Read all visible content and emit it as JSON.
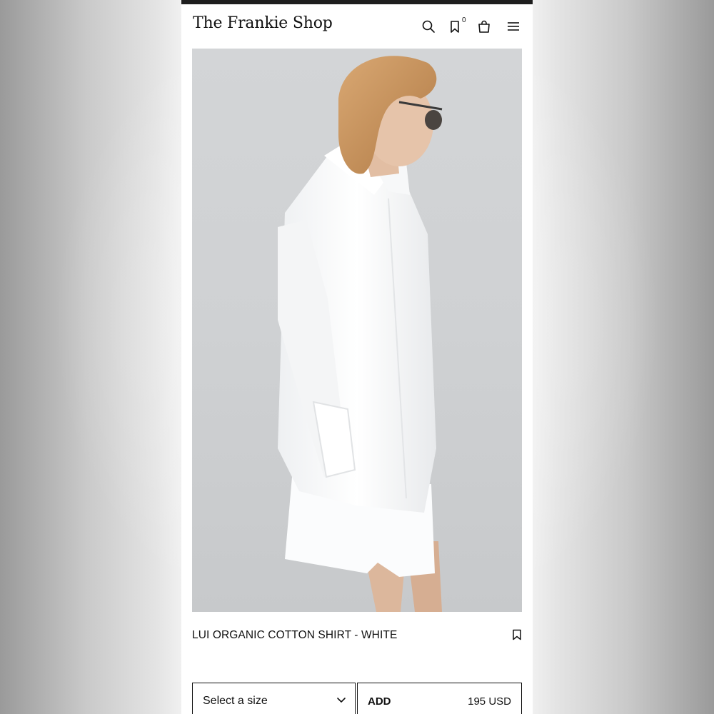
{
  "header": {
    "logo": "The Frankie Shop",
    "wishlist_count": "0",
    "icons": [
      "search-icon",
      "bookmark-icon",
      "shopping-bag-icon",
      "menu-icon"
    ]
  },
  "product": {
    "image_alt": "Model wearing white oversized shirt and white shorts",
    "title": "LUI ORGANIC COTTON SHIRT - WHITE",
    "size_select": {
      "selected": "Select a size"
    },
    "add_label": "ADD",
    "price": "195 USD"
  },
  "colors": {
    "text": "#111111",
    "background": "#ffffff",
    "image_backdrop": "#d0d2d4"
  }
}
